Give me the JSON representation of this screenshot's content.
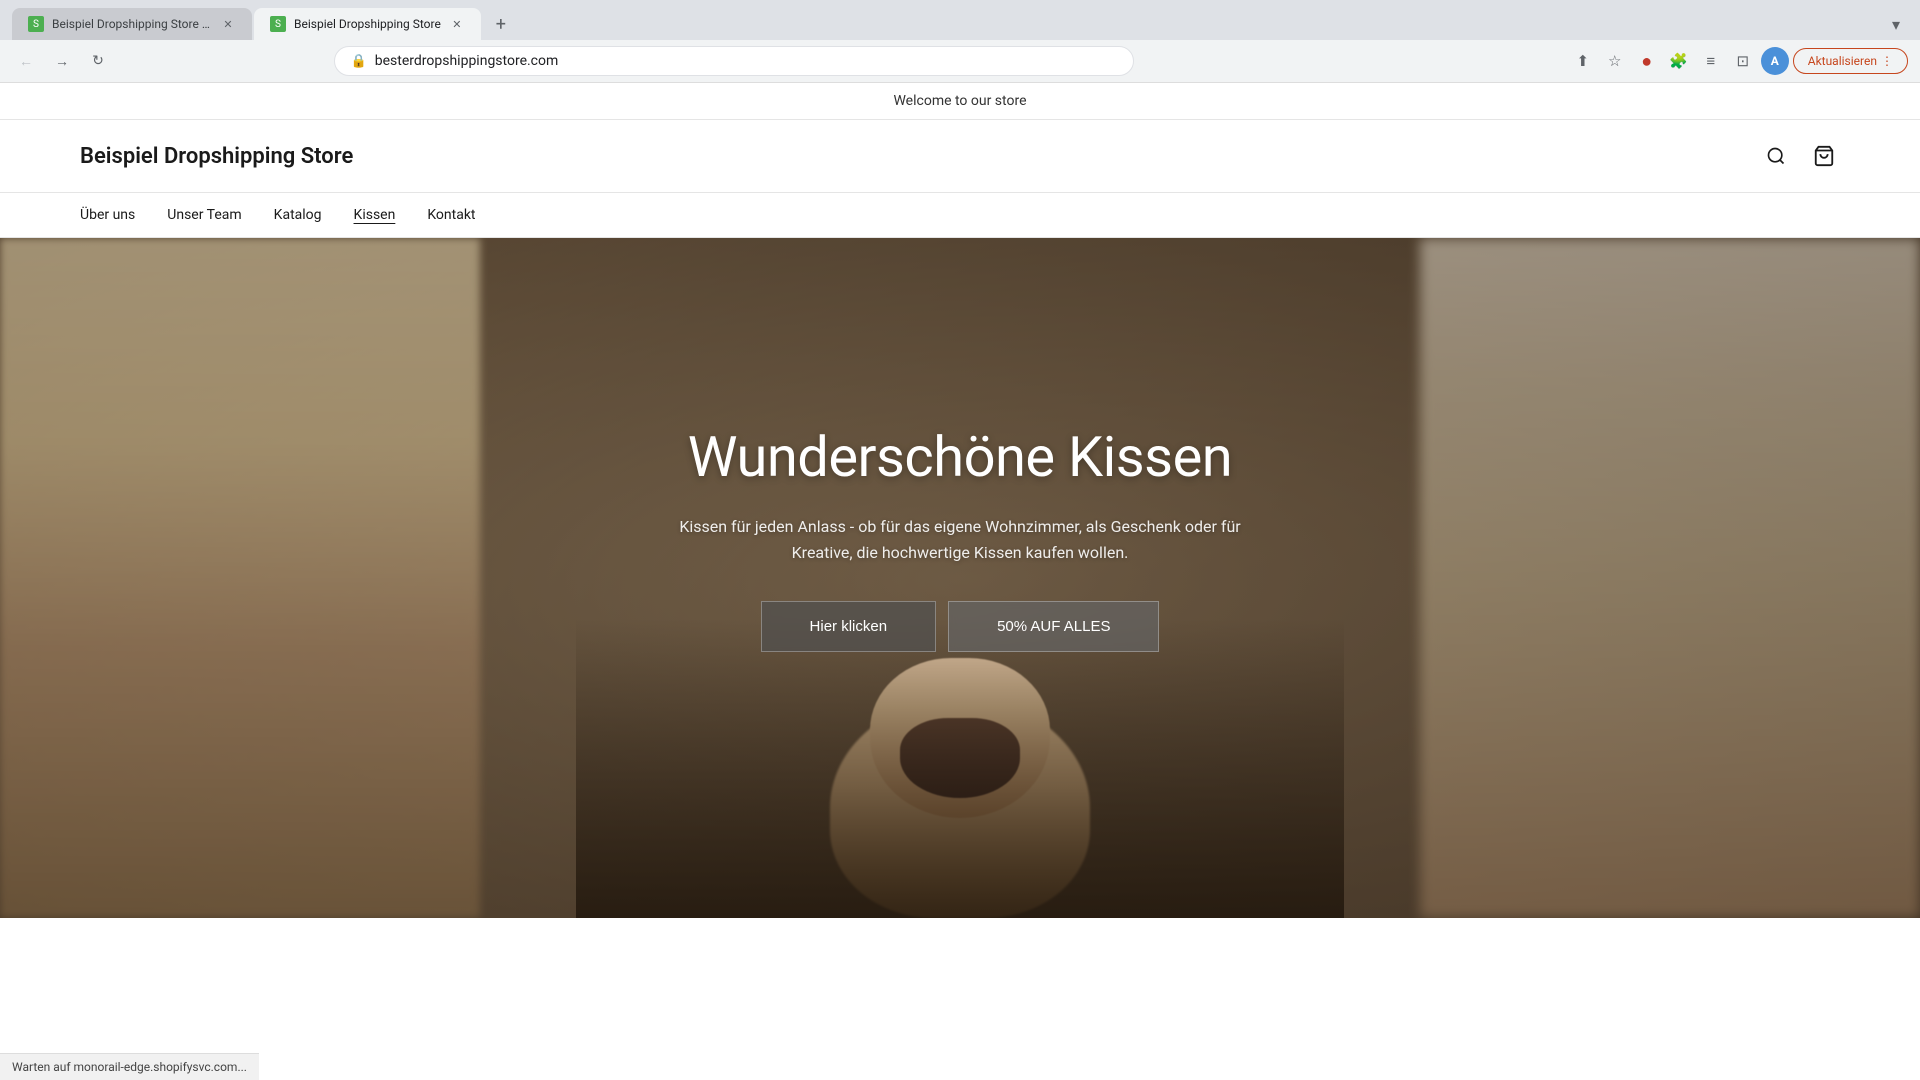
{
  "browser": {
    "tabs": [
      {
        "id": "tab1",
        "title": "Beispiel Dropshipping Store · ...",
        "active": false,
        "favicon": "S"
      },
      {
        "id": "tab2",
        "title": "Beispiel Dropshipping Store",
        "active": true,
        "favicon": "S"
      }
    ],
    "new_tab_label": "+",
    "tab_right_label": "▾",
    "address": "besterdropshippingstore.com",
    "nav": {
      "back_disabled": true,
      "forward_disabled": false,
      "reload": "↻"
    },
    "update_btn": "Aktualisieren",
    "toolbar_icons": {
      "share": "⬆",
      "bookmark": "☆",
      "opera": "●",
      "extensions": "🧩",
      "reader": "≡",
      "split": "⊡",
      "profile": "A"
    }
  },
  "site": {
    "announcement": "Welcome to our store",
    "logo": "Beispiel Dropshipping Store",
    "nav_links": [
      {
        "id": "uber-uns",
        "label": "Über uns",
        "active": false
      },
      {
        "id": "unser-team",
        "label": "Unser Team",
        "active": false
      },
      {
        "id": "katalog",
        "label": "Katalog",
        "active": false
      },
      {
        "id": "kissen",
        "label": "Kissen",
        "active": true
      },
      {
        "id": "kontakt",
        "label": "Kontakt",
        "active": false
      }
    ],
    "hero": {
      "title": "Wunderschöne Kissen",
      "subtitle": "Kissen für jeden Anlass - ob für das eigene Wohnzimmer, als Geschenk oder für Kreative, die hochwertige Kissen kaufen wollen.",
      "btn_primary": "Hier klicken",
      "btn_secondary": "50% AUF ALLES"
    },
    "status_bar": "Warten auf monorail-edge.shopifysvc.com..."
  }
}
